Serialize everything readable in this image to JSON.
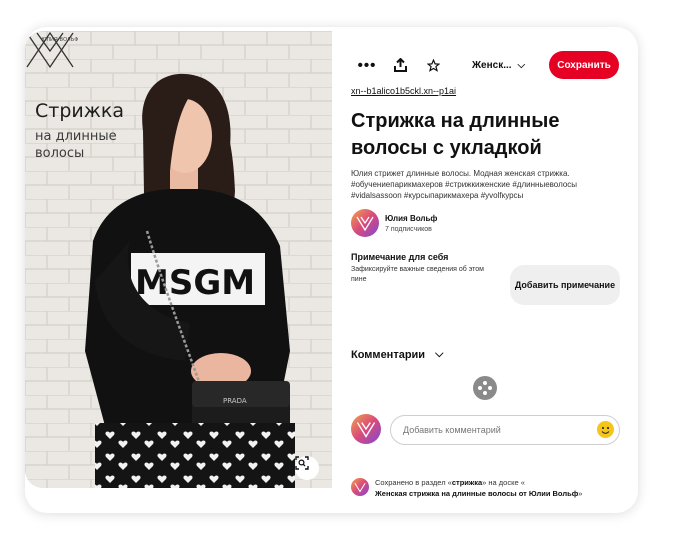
{
  "image": {
    "brand": "ЮЛИЯ ВОЛЬФ",
    "title": "Стрижка",
    "subtitle": "на длинные волосы",
    "sweater_text": "MSGM",
    "bag_text": "PRADA"
  },
  "toolbar": {
    "more_icon": "more-horizontal-icon",
    "share_icon": "share-icon",
    "star_icon": "star-icon",
    "board_label": "Женск...",
    "save_label": "Сохранить",
    "accent": "#e60023"
  },
  "pin": {
    "link": "xn--b1alico1b5ckl.xn--p1ai",
    "title": "Стрижка на длинные волосы с укладкой",
    "description": "Юлия стрижет длинные волосы. Модная женская стрижка. #обучениепарикмахеров #стрижкиженские #длинныеволосы #vidalsassoon #курсыпарикмахера #yvolfкурсы"
  },
  "author": {
    "name": "Юлия Вольф",
    "followers": "7 подписчиков"
  },
  "note": {
    "title": "Примечание для себя",
    "subtitle": "Зафиксируйте важные сведения об этом пине",
    "button": "Добавить примечание"
  },
  "comments": {
    "title": "Комментарии",
    "placeholder": "Добавить комментарий"
  },
  "saved": {
    "prefix": "Сохранено в раздел «",
    "section": "стрижка",
    "middle": "» на доске «",
    "board": "Женская стрижка на длинные волосы от Юлии Вольф",
    "suffix": "»"
  }
}
